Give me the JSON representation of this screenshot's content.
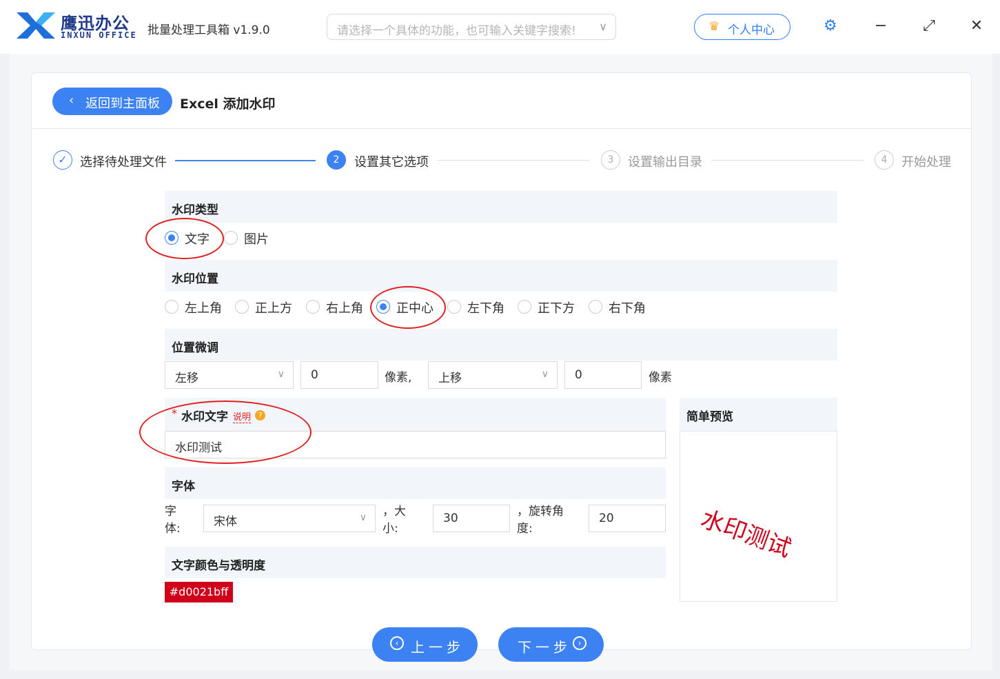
{
  "window": {
    "brand_cn": "鹰迅办公",
    "brand_en": "INXUN OFFICE",
    "app_title": "批量处理工具箱 v1.9.0",
    "search_placeholder": "请选择一个具体的功能，也可输入关键字搜索!",
    "user_center": "个人中心",
    "minimize": "−",
    "maximize": "⤢",
    "close": "✕"
  },
  "header": {
    "back_label": "返回到主面板",
    "page_title": "Excel 添加水印"
  },
  "steps": [
    {
      "num": "✓",
      "label": "选择待处理文件",
      "state": "done"
    },
    {
      "num": "2",
      "label": "设置其它选项",
      "state": "active"
    },
    {
      "num": "3",
      "label": "设置输出目录",
      "state": "pending"
    },
    {
      "num": "4",
      "label": "开始处理",
      "state": "pending"
    }
  ],
  "watermark_type": {
    "title": "水印类型",
    "options": [
      "文字",
      "图片"
    ],
    "selected": "文字"
  },
  "watermark_position": {
    "title": "水印位置",
    "options": [
      "左上角",
      "正上方",
      "右上角",
      "正中心",
      "左下角",
      "正下方",
      "右下角"
    ],
    "selected": "正中心"
  },
  "fine_tune": {
    "title": "位置微调",
    "h_direction": "左移",
    "h_value": "0",
    "unit1": "像素,",
    "v_direction": "上移",
    "v_value": "0",
    "unit2": "像素"
  },
  "watermark_text": {
    "required_mark": "*",
    "title": "水印文字",
    "help_link": "说明",
    "value": "水印测试"
  },
  "font": {
    "title": "字体",
    "font_label": "字体:",
    "font_value": "宋体",
    "size_label": "，大小:",
    "size_value": "30",
    "rotate_label": "，旋转角度:",
    "rotate_value": "20"
  },
  "color": {
    "title": "文字颜色与透明度",
    "value": "#d0021bff"
  },
  "preview": {
    "title": "简单预览",
    "text": "水印测试"
  },
  "nav": {
    "prev": "上一步",
    "next": "下一步"
  },
  "colors": {
    "accent": "#3d82f2",
    "watermark": "#d0021b",
    "highlight": "#e02020"
  }
}
